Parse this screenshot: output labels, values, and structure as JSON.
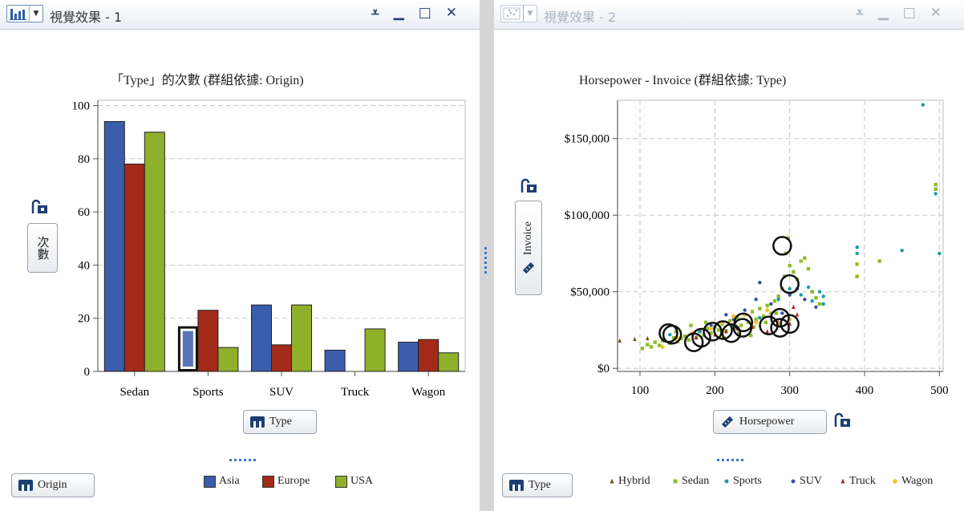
{
  "panes": [
    {
      "header": {
        "title": "視覺效果 - 1",
        "icon": "bar-chart-icon",
        "active": true
      },
      "role_buttons": {
        "x_role": "Type",
        "group_role": "Origin"
      }
    },
    {
      "header": {
        "title": "視覺效果 - 2",
        "icon": "scatter-plot-icon",
        "active": false
      },
      "role_buttons": {
        "x_role": "Horsepower",
        "y_role": "Invoice",
        "group_role": "Type"
      }
    }
  ],
  "chart_data": [
    {
      "type": "bar",
      "title": "「Type」的次數 (群組依據: Origin)",
      "xlabel": "Type",
      "ylabel": "次數",
      "categories": [
        "Sedan",
        "Sports",
        "SUV",
        "Truck",
        "Wagon"
      ],
      "yticks": [
        "0",
        "20",
        "40",
        "60",
        "80",
        "100"
      ],
      "ylim": [
        0,
        102
      ],
      "grid": true,
      "legend_position": "bottom",
      "selected": {
        "series": "Asia",
        "category": "Sports"
      },
      "series": [
        {
          "name": "Asia",
          "color": "#3a5dab",
          "values": [
            94,
            17,
            25,
            8,
            11
          ]
        },
        {
          "name": "Europe",
          "color": "#a32a18",
          "values": [
            78,
            23,
            10,
            0,
            12
          ]
        },
        {
          "name": "USA",
          "color": "#8fb02b",
          "values": [
            90,
            9,
            25,
            16,
            7
          ]
        }
      ]
    },
    {
      "type": "scatter",
      "title": "Horsepower - Invoice (群組依據: Type)",
      "xlabel": "Horsepower",
      "ylabel": "Invoice",
      "xticks": [
        "100",
        "200",
        "300",
        "400",
        "500"
      ],
      "yticks": [
        "$0",
        "$50,000",
        "$100,000",
        "$150,000"
      ],
      "xlim": [
        70,
        505
      ],
      "ylim": [
        -2000,
        175000
      ],
      "grid": true,
      "legend_position": "bottom",
      "series": [
        {
          "name": "Hybrid",
          "color": "#6b5412",
          "marker": "triangle",
          "points": [
            [
              73,
              18000
            ],
            [
              93,
              19000
            ],
            [
              110,
              19500
            ]
          ]
        },
        {
          "name": "Sedan",
          "color": "#8fbc2a",
          "marker": "square",
          "points": [
            [
              103,
              13000
            ],
            [
              110,
              15500
            ],
            [
              115,
              14000
            ],
            [
              120,
              17000
            ],
            [
              126,
              15000
            ],
            [
              130,
              18000
            ],
            [
              140,
              16500
            ],
            [
              145,
              20000
            ],
            [
              150,
              17500
            ],
            [
              155,
              19500
            ],
            [
              160,
              21000
            ],
            [
              165,
              18500
            ],
            [
              170,
              22500
            ],
            [
              175,
              20000
            ],
            [
              180,
              24000
            ],
            [
              185,
              21500
            ],
            [
              190,
              26000
            ],
            [
              195,
              23000
            ],
            [
              200,
              27000
            ],
            [
              205,
              25000
            ],
            [
              210,
              29000
            ],
            [
              215,
              24500
            ],
            [
              220,
              31000
            ],
            [
              225,
              26500
            ],
            [
              230,
              33000
            ],
            [
              235,
              28000
            ],
            [
              240,
              35000
            ],
            [
              245,
              30000
            ],
            [
              250,
              37000
            ],
            [
              255,
              32000
            ],
            [
              260,
              39000
            ],
            [
              265,
              34000
            ],
            [
              270,
              41000
            ],
            [
              275,
              36000
            ],
            [
              280,
              44000
            ],
            [
              285,
              47000
            ],
            [
              290,
              52000
            ],
            [
              293,
              60000
            ],
            [
              295,
              75000
            ],
            [
              298,
              85000
            ],
            [
              300,
              67000
            ],
            [
              305,
              63000
            ],
            [
              310,
              58000
            ],
            [
              315,
              70000
            ],
            [
              320,
              72000
            ],
            [
              325,
              65000
            ],
            [
              330,
              50000
            ],
            [
              335,
              46000
            ],
            [
              340,
              42000
            ],
            [
              390,
              60000
            ],
            [
              390,
              68000
            ],
            [
              420,
              70000
            ],
            [
              495,
              120000
            ],
            [
              495,
              117000
            ],
            [
              212,
              20000
            ],
            [
              232,
              23000
            ],
            [
              252,
              27000
            ],
            [
              268,
              30000
            ],
            [
              282,
              36000
            ],
            [
              248,
              21500
            ],
            [
              228,
              33000
            ],
            [
              188,
              30000
            ],
            [
              168,
              28000
            ],
            [
              148,
              24000
            ]
          ]
        },
        {
          "name": "Sports",
          "color": "#1a9aa6",
          "marker": "circle",
          "points": [
            [
              140,
              22000
            ],
            [
              180,
              24000
            ],
            [
              225,
              28000
            ],
            [
              260,
              33000
            ],
            [
              285,
              45000
            ],
            [
              300,
              52000
            ],
            [
              315,
              48000
            ],
            [
              325,
              53000
            ],
            [
              330,
              44000
            ],
            [
              340,
              50000
            ],
            [
              345,
              47000
            ],
            [
              345,
              42000
            ],
            [
              390,
              75000
            ],
            [
              390,
              79000
            ],
            [
              450,
              77000
            ],
            [
              478,
              172000
            ],
            [
              495,
              114000
            ],
            [
              500,
              75000
            ]
          ]
        },
        {
          "name": "SUV",
          "color": "#3553a6",
          "marker": "circle",
          "points": [
            [
              195,
              28000
            ],
            [
              215,
              35000
            ],
            [
              225,
              32000
            ],
            [
              240,
              38000
            ],
            [
              255,
              45000
            ],
            [
              260,
              56000
            ],
            [
              275,
              42000
            ],
            [
              290,
              36000
            ],
            [
              300,
              48000
            ],
            [
              310,
              52000
            ],
            [
              320,
              45000
            ],
            [
              335,
              40000
            ]
          ]
        },
        {
          "name": "Truck",
          "color": "#b02420",
          "marker": "triangle",
          "points": [
            [
              175,
              20000
            ],
            [
              200,
              22000
            ],
            [
              215,
              24000
            ],
            [
              230,
              26000
            ],
            [
              250,
              27000
            ],
            [
              270,
              24000
            ],
            [
              285,
              30000
            ],
            [
              300,
              29000
            ],
            [
              305,
              40000
            ],
            [
              310,
              35000
            ]
          ]
        },
        {
          "name": "Wagon",
          "color": "#f2c12e",
          "marker": "diamond",
          "points": [
            [
              130,
              14000
            ],
            [
              150,
              20000
            ],
            [
              170,
              23000
            ],
            [
              195,
              26000
            ],
            [
              210,
              30000
            ],
            [
              225,
              34000
            ],
            [
              240,
              35000
            ],
            [
              255,
              30000
            ],
            [
              270,
              38000
            ],
            [
              285,
              29000
            ],
            [
              300,
              32000
            ]
          ]
        }
      ],
      "highlighted": [
        [
          138,
          23000
        ],
        [
          143,
          22000
        ],
        [
          172,
          17000
        ],
        [
          182,
          20000
        ],
        [
          197,
          24000
        ],
        [
          211,
          25000
        ],
        [
          222,
          23000
        ],
        [
          237,
          26500
        ],
        [
          238,
          30000
        ],
        [
          272,
          28000
        ],
        [
          287,
          26500
        ],
        [
          287,
          33000
        ],
        [
          300,
          29000
        ],
        [
          290,
          80000
        ],
        [
          300,
          55000
        ]
      ]
    }
  ]
}
